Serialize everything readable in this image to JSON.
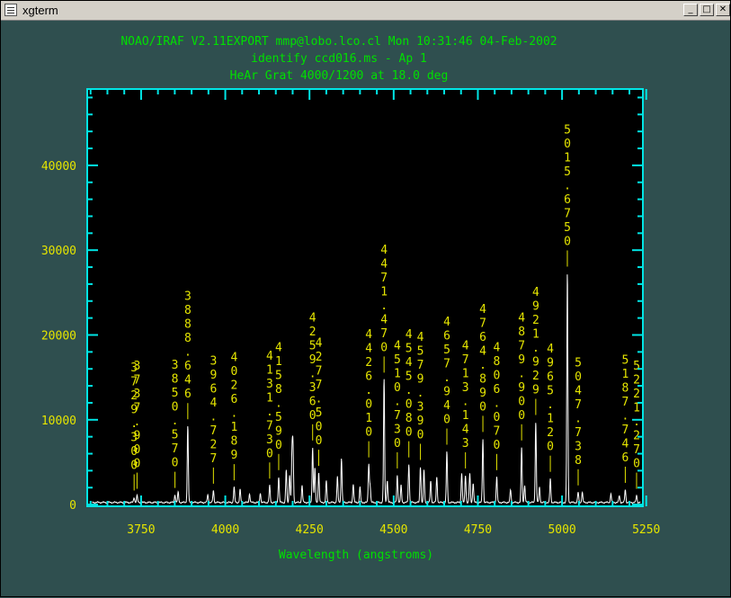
{
  "window": {
    "title": "xgterm",
    "app_icon": "terminal-icon",
    "buttons": {
      "minimize": "_",
      "maximize": "□",
      "close": "✕"
    }
  },
  "colors": {
    "background": "#2f4f4f",
    "title_text": "#00e000",
    "frame": "#00e5e5",
    "tick_labels": "#e5e500",
    "line_labels": "#e5e500",
    "spectrum": "#ffffff",
    "plot_bg": "#000000"
  },
  "plot": {
    "title_lines": [
      "NOAO/IRAF V2.11EXPORT mmp@lobo.lco.cl Mon 10:31:46 04-Feb-2002",
      "identify ccd016.ms - Ap 1",
      "HeAr Grat 4000/1200 at 18.0 deg"
    ],
    "xlabel": "Wavelength (angstroms)"
  },
  "chart_data": {
    "type": "line",
    "title": "identify ccd016.ms - Ap 1",
    "subtitle": "HeAr Grat 4000/1200 at 18.0 deg",
    "xlabel": "Wavelength (angstroms)",
    "ylabel": "",
    "xlim": [
      3590,
      5240
    ],
    "ylim": [
      -200,
      49000
    ],
    "xticks": [
      3750,
      4000,
      4250,
      4500,
      4750,
      5000,
      5250
    ],
    "yticks": [
      0,
      10000,
      20000,
      30000,
      40000
    ],
    "xtick_labels": [
      "3750",
      "4000",
      "4250",
      "4500",
      "4750",
      "5000",
      "5250"
    ],
    "ytick_labels": [
      "0",
      "10000",
      "20000",
      "30000",
      "40000"
    ],
    "grid": false,
    "identified_lines": [
      {
        "label": "3729.300",
        "wavelength": 3729.3,
        "peak": 600
      },
      {
        "label": "3737.900",
        "wavelength": 3737.9,
        "peak": 800
      },
      {
        "label": "3850.570",
        "wavelength": 3850.57,
        "peak": 900
      },
      {
        "label": "3888.646",
        "wavelength": 3888.646,
        "peak": 9000
      },
      {
        "label": "3964.727",
        "wavelength": 3964.727,
        "peak": 1400
      },
      {
        "label": "4026.189",
        "wavelength": 4026.189,
        "peak": 1800
      },
      {
        "label": "4131.730",
        "wavelength": 4131.73,
        "peak": 2000
      },
      {
        "label": "4158.590",
        "wavelength": 4158.59,
        "peak": 3000
      },
      {
        "label": "4259.360",
        "wavelength": 4259.36,
        "peak": 6500
      },
      {
        "label": "4277.500",
        "wavelength": 4277.5,
        "peak": 3500
      },
      {
        "label": "4426.010",
        "wavelength": 4426.01,
        "peak": 4500
      },
      {
        "label": "4471.470",
        "wavelength": 4471.47,
        "peak": 14500
      },
      {
        "label": "4510.730",
        "wavelength": 4510.73,
        "peak": 3200
      },
      {
        "label": "4545.080",
        "wavelength": 4545.08,
        "peak": 4500
      },
      {
        "label": "4579.390",
        "wavelength": 4579.39,
        "peak": 4200
      },
      {
        "label": "4657.940",
        "wavelength": 4657.94,
        "peak": 6000
      },
      {
        "label": "4713.143",
        "wavelength": 4713.143,
        "peak": 3200
      },
      {
        "label": "4764.890",
        "wavelength": 4764.89,
        "peak": 7500
      },
      {
        "label": "4806.070",
        "wavelength": 4806.07,
        "peak": 3000
      },
      {
        "label": "4879.900",
        "wavelength": 4879.9,
        "peak": 6500
      },
      {
        "label": "4921.929",
        "wavelength": 4921.929,
        "peak": 9500
      },
      {
        "label": "4965.120",
        "wavelength": 4965.12,
        "peak": 2800
      },
      {
        "label": "5015.6750",
        "wavelength": 5015.675,
        "peak": 27000
      },
      {
        "label": "5047.738",
        "wavelength": 5047.738,
        "peak": 1200
      },
      {
        "label": "5187.746",
        "wavelength": 5187.746,
        "peak": 1500
      },
      {
        "label": "5221.270",
        "wavelength": 5221.27,
        "peak": 800
      }
    ],
    "unmarked_peaks": [
      {
        "wavelength": 3860,
        "peak": 1200
      },
      {
        "wavelength": 3948,
        "peak": 900
      },
      {
        "wavelength": 4044,
        "peak": 1500
      },
      {
        "wavelength": 4072,
        "peak": 1000
      },
      {
        "wavelength": 4104,
        "peak": 1100
      },
      {
        "wavelength": 4181,
        "peak": 3800
      },
      {
        "wavelength": 4191,
        "peak": 3300
      },
      {
        "wavelength": 4198,
        "peak": 5500
      },
      {
        "wavelength": 4201,
        "peak": 6400
      },
      {
        "wavelength": 4228,
        "peak": 2000
      },
      {
        "wavelength": 4266,
        "peak": 4000
      },
      {
        "wavelength": 4300,
        "peak": 2500
      },
      {
        "wavelength": 4333,
        "peak": 3000
      },
      {
        "wavelength": 4345,
        "peak": 5200
      },
      {
        "wavelength": 4380,
        "peak": 2200
      },
      {
        "wavelength": 4400,
        "peak": 1800
      },
      {
        "wavelength": 4430,
        "peak": 2000
      },
      {
        "wavelength": 4481,
        "peak": 2600
      },
      {
        "wavelength": 4522,
        "peak": 2000
      },
      {
        "wavelength": 4590,
        "peak": 3800
      },
      {
        "wavelength": 4610,
        "peak": 2500
      },
      {
        "wavelength": 4628,
        "peak": 3000
      },
      {
        "wavelength": 4702,
        "peak": 3500
      },
      {
        "wavelength": 4726,
        "peak": 3400
      },
      {
        "wavelength": 4736,
        "peak": 2300
      },
      {
        "wavelength": 4847,
        "peak": 1500
      },
      {
        "wavelength": 4889,
        "peak": 2000
      },
      {
        "wavelength": 4933,
        "peak": 1800
      },
      {
        "wavelength": 5060,
        "peak": 1200
      },
      {
        "wavelength": 5145,
        "peak": 1000
      },
      {
        "wavelength": 5170,
        "peak": 800
      },
      {
        "wavelength": 5235,
        "peak": 700
      }
    ]
  }
}
